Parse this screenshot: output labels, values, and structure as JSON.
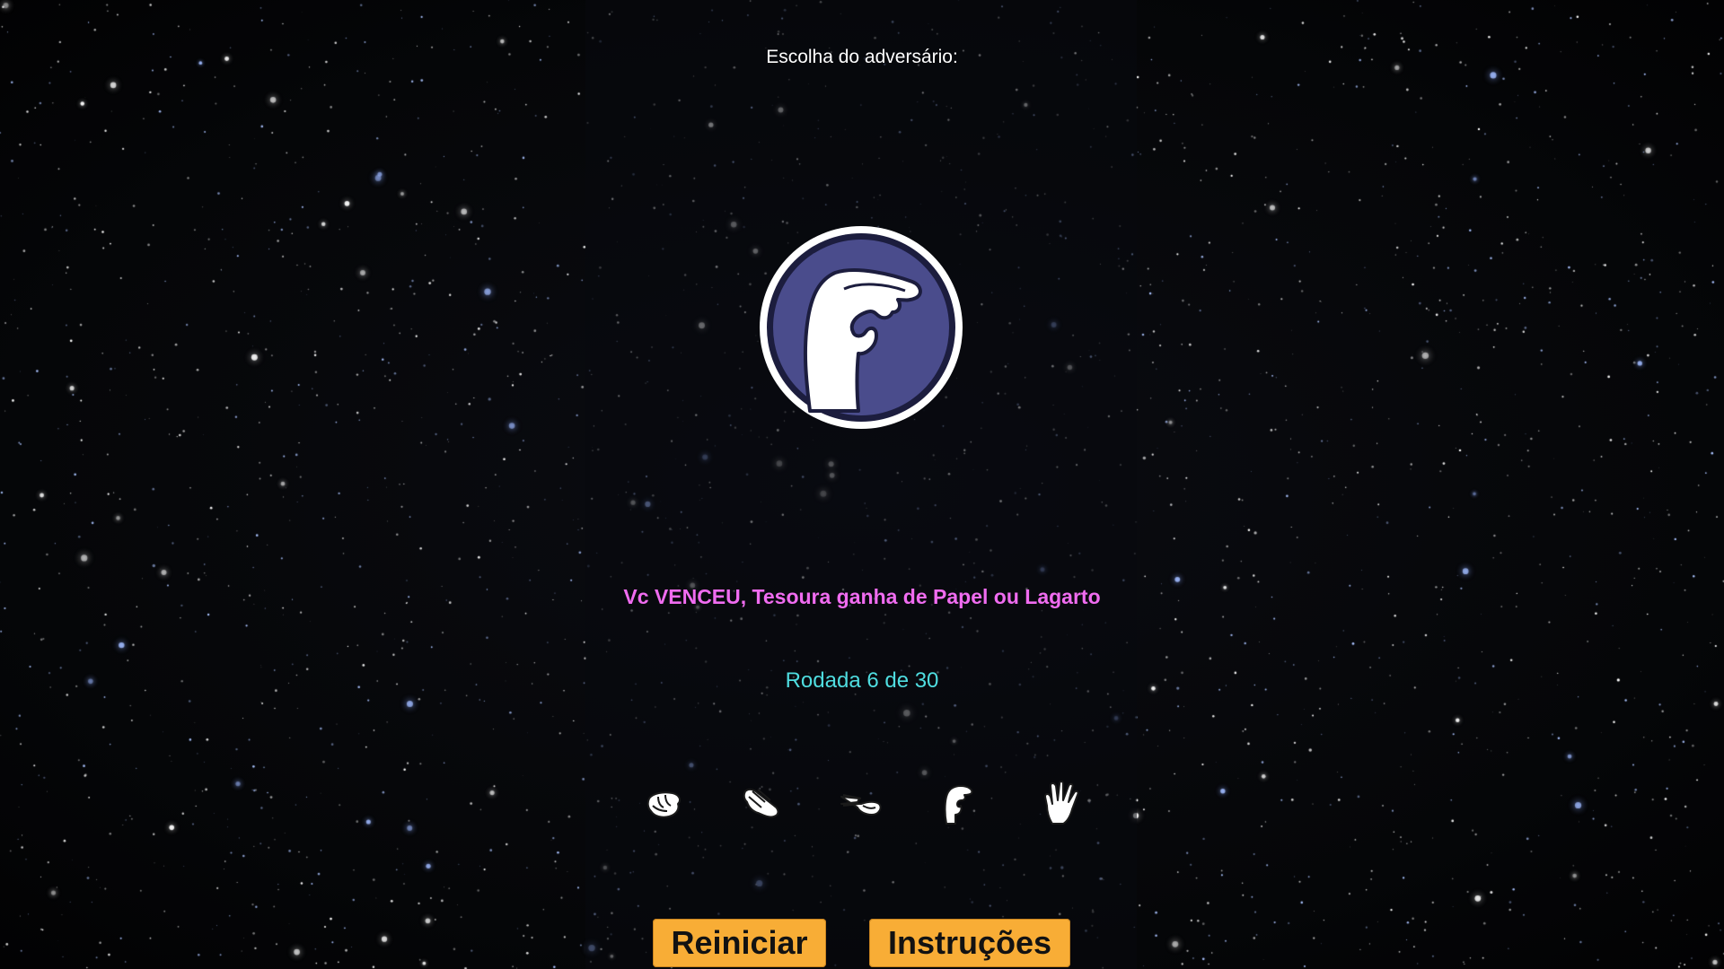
{
  "opponent": {
    "label": "Escolha do adversário:",
    "choice_icon": "lizard-hand-icon"
  },
  "result": {
    "message": "Vc VENCEU, Tesoura ganha de Papel ou Lagarto",
    "color": "#f06cf0"
  },
  "round": {
    "text": "Rodada 6 de 30",
    "current": 6,
    "total": 30,
    "color": "#4fdde0"
  },
  "choices": [
    {
      "icon": "rock-hand-icon"
    },
    {
      "icon": "paper-hand-icon"
    },
    {
      "icon": "scissors-hand-icon"
    },
    {
      "icon": "lizard-hand-icon"
    },
    {
      "icon": "spock-hand-icon"
    }
  ],
  "buttons": {
    "restart_label": "Reiniciar",
    "instructions_label": "Instruções",
    "color": "#f8ad36"
  },
  "colors": {
    "medallion_fill": "#4a4c8c",
    "medallion_ring": "#1c1d3e",
    "background": "#050608"
  }
}
